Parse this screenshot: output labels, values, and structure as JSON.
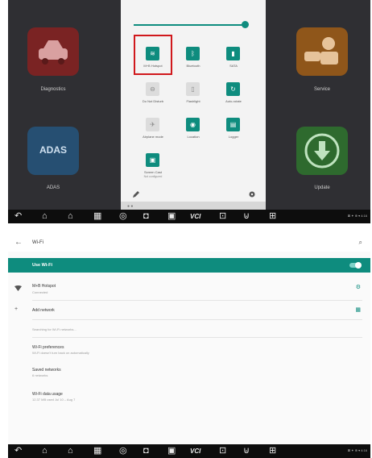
{
  "home": {
    "apps": [
      {
        "label": "Diagnostics",
        "color": "#9c2b2b",
        "icon": "car-icon"
      },
      {
        "label": "Service",
        "color": "#b5691b",
        "icon": "mechanic-icon"
      },
      {
        "label": "ADAS",
        "color": "#2c5f8a",
        "icon": "adas-icon"
      },
      {
        "label": "Update",
        "color": "#3a7d3a",
        "icon": "download-icon"
      }
    ],
    "adas_text": "ADAS"
  },
  "quick_settings": {
    "tiles": [
      {
        "label": "M+B Hotspot",
        "sub": "",
        "state": "on",
        "icon": "wifi-icon",
        "glyph": "≋"
      },
      {
        "label": "Bluetooth",
        "sub": "",
        "state": "on",
        "icon": "bluetooth-icon",
        "glyph": "ᛒ"
      },
      {
        "label": "SATA",
        "sub": "",
        "state": "on",
        "icon": "storage-icon",
        "glyph": "▮"
      },
      {
        "label": "Do Not Disturb",
        "sub": "",
        "state": "off",
        "icon": "dnd-icon",
        "glyph": "⊖"
      },
      {
        "label": "Flashlight",
        "sub": "",
        "state": "off",
        "icon": "flashlight-icon",
        "glyph": "▯"
      },
      {
        "label": "Auto-rotate",
        "sub": "",
        "state": "on",
        "icon": "rotate-icon",
        "glyph": "↻"
      },
      {
        "label": "Airplane mode",
        "sub": "",
        "state": "off",
        "icon": "airplane-icon",
        "glyph": "✈"
      },
      {
        "label": "Location",
        "sub": "",
        "state": "on",
        "icon": "location-icon",
        "glyph": "◉"
      },
      {
        "label": "Logger",
        "sub": "",
        "state": "on",
        "icon": "logger-icon",
        "glyph": "▤"
      },
      {
        "label": "Screen Cast",
        "sub": "Not configured",
        "state": "on",
        "icon": "cast-icon",
        "glyph": "▣"
      }
    ]
  },
  "navbar": {
    "icons": [
      "back-icon",
      "home-icon",
      "house-icon",
      "recents-icon",
      "browser-icon",
      "camera-icon",
      "screen-record-icon",
      "vci-icon",
      "car-nav-icon",
      "tpms-icon",
      "network-icon"
    ],
    "glyphs": [
      "↶",
      "⌂",
      "⌂",
      "▦",
      "◎",
      "◘",
      "▣",
      "VCI",
      "⊡",
      "⊍",
      "⊞"
    ],
    "status": "⊠ ✦ ⊕ ▾ 4:16"
  },
  "wifi": {
    "title": "Wi-Fi",
    "use_wifi": "Use Wi-Fi",
    "network": {
      "name": "M+B Hotspot",
      "status": "Connected"
    },
    "add_network": "Add network",
    "searching": "Searching for Wi-Fi networks...",
    "preferences": {
      "title": "Wi-Fi preferences",
      "sub": "Wi-Fi doesn't turn back on automatically"
    },
    "saved": {
      "title": "Saved networks",
      "sub": "6 networks"
    },
    "usage": {
      "title": "Wi-Fi data usage",
      "sub": "12.37 MB used Jul 10 – Aug 7"
    }
  },
  "colors": {
    "accent": "#0e8c7e",
    "highlight": "#d0181c",
    "dark": "#2f2f33"
  }
}
